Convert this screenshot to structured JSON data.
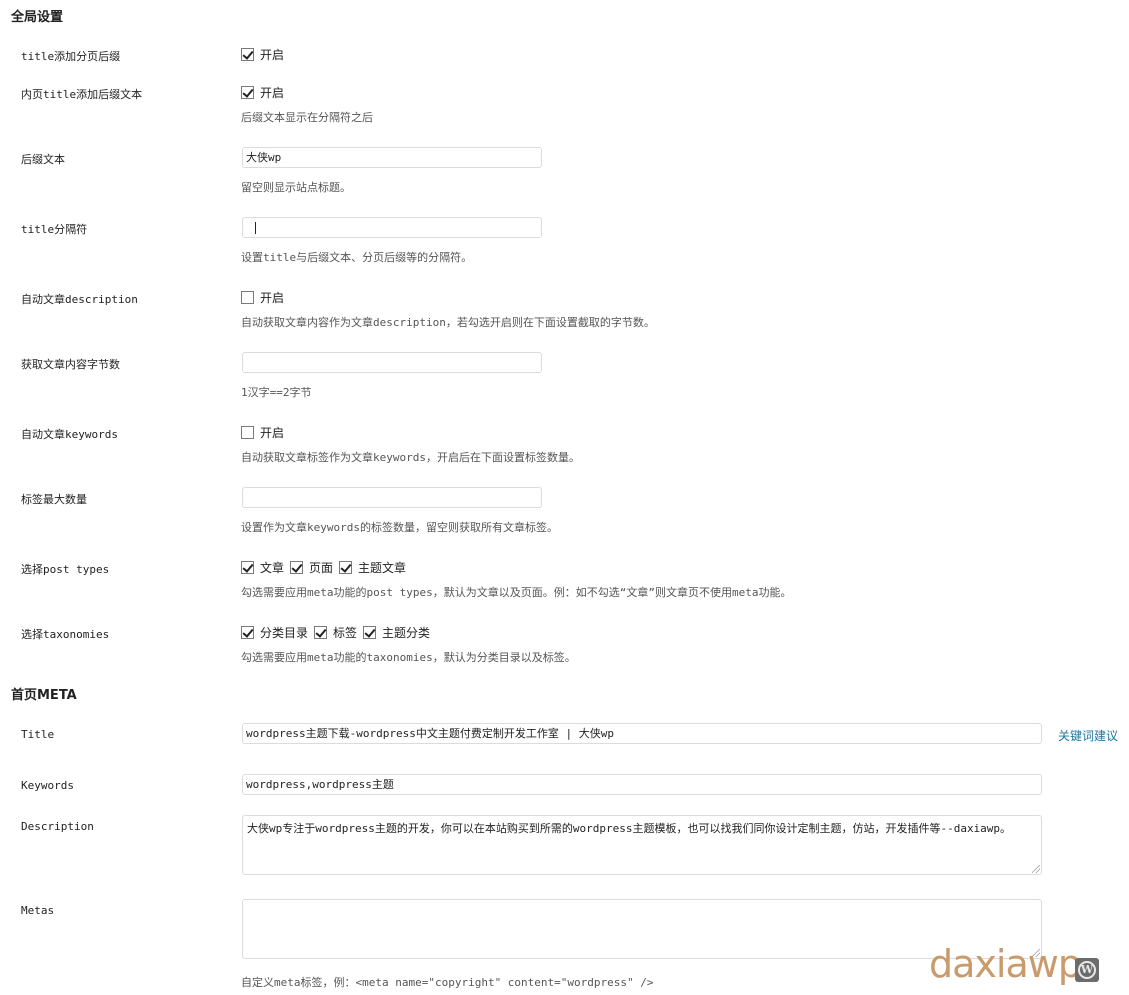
{
  "sections": {
    "global": "全局设置",
    "home_meta": "首页META"
  },
  "global": {
    "title_paging": {
      "label": "title添加分页后缀",
      "option": "开启",
      "checked": true
    },
    "inner_title_suffix": {
      "label": "内页title添加后缀文本",
      "option": "开启",
      "checked": true,
      "desc": "后缀文本显示在分隔符之后"
    },
    "suffix_text": {
      "label": "后缀文本",
      "value": "大侠wp",
      "desc": "留空则显示站点标题。"
    },
    "title_separator": {
      "label": "title分隔符",
      "value": "",
      "desc": "设置title与后缀文本、分页后缀等的分隔符。"
    },
    "auto_description": {
      "label": "自动文章description",
      "option": "开启",
      "checked": false,
      "desc": "自动获取文章内容作为文章description，若勾选开启则在下面设置截取的字节数。"
    },
    "content_bytes": {
      "label": "获取文章内容字节数",
      "value": "",
      "desc": "1汉字==2字节"
    },
    "auto_keywords": {
      "label": "自动文章keywords",
      "option": "开启",
      "checked": false,
      "desc": "自动获取文章标签作为文章keywords，开启后在下面设置标签数量。"
    },
    "max_tags": {
      "label": "标签最大数量",
      "value": "",
      "desc": "设置作为文章keywords的标签数量，留空则获取所有文章标签。"
    },
    "post_types": {
      "label": "选择post types",
      "options": [
        {
          "label": "文章",
          "checked": true
        },
        {
          "label": "页面",
          "checked": true
        },
        {
          "label": "主题文章",
          "checked": true
        }
      ],
      "desc": "勾选需要应用meta功能的post types，默认为文章以及页面。例：如不勾选“文章”则文章页不使用meta功能。"
    },
    "taxonomies": {
      "label": "选择taxonomies",
      "options": [
        {
          "label": "分类目录",
          "checked": true
        },
        {
          "label": "标签",
          "checked": true
        },
        {
          "label": "主题分类",
          "checked": true
        }
      ],
      "desc": "勾选需要应用meta功能的taxonomies，默认为分类目录以及标签。"
    }
  },
  "home": {
    "title": {
      "label": "Title",
      "value": "wordpress主题下载-wordpress中文主题付费定制开发工作室 | 大侠wp",
      "link": "关键词建议"
    },
    "keywords": {
      "label": "Keywords",
      "value": "wordpress,wordpress主题"
    },
    "description": {
      "label": "Description",
      "value": "大侠wp专注于wordpress主题的开发，你可以在本站购买到所需的wordpress主题模板，也可以找我们同你设计定制主题，仿站，开发插件等--daxiawp。"
    },
    "metas": {
      "label": "Metas",
      "value": "",
      "desc": "自定义meta标签，例：<meta name=\"copyright\" content=\"wordpress\" />"
    }
  },
  "watermark": {
    "text": "daxiawp",
    "logo_letter": "W",
    "color": "#c99a6a"
  }
}
